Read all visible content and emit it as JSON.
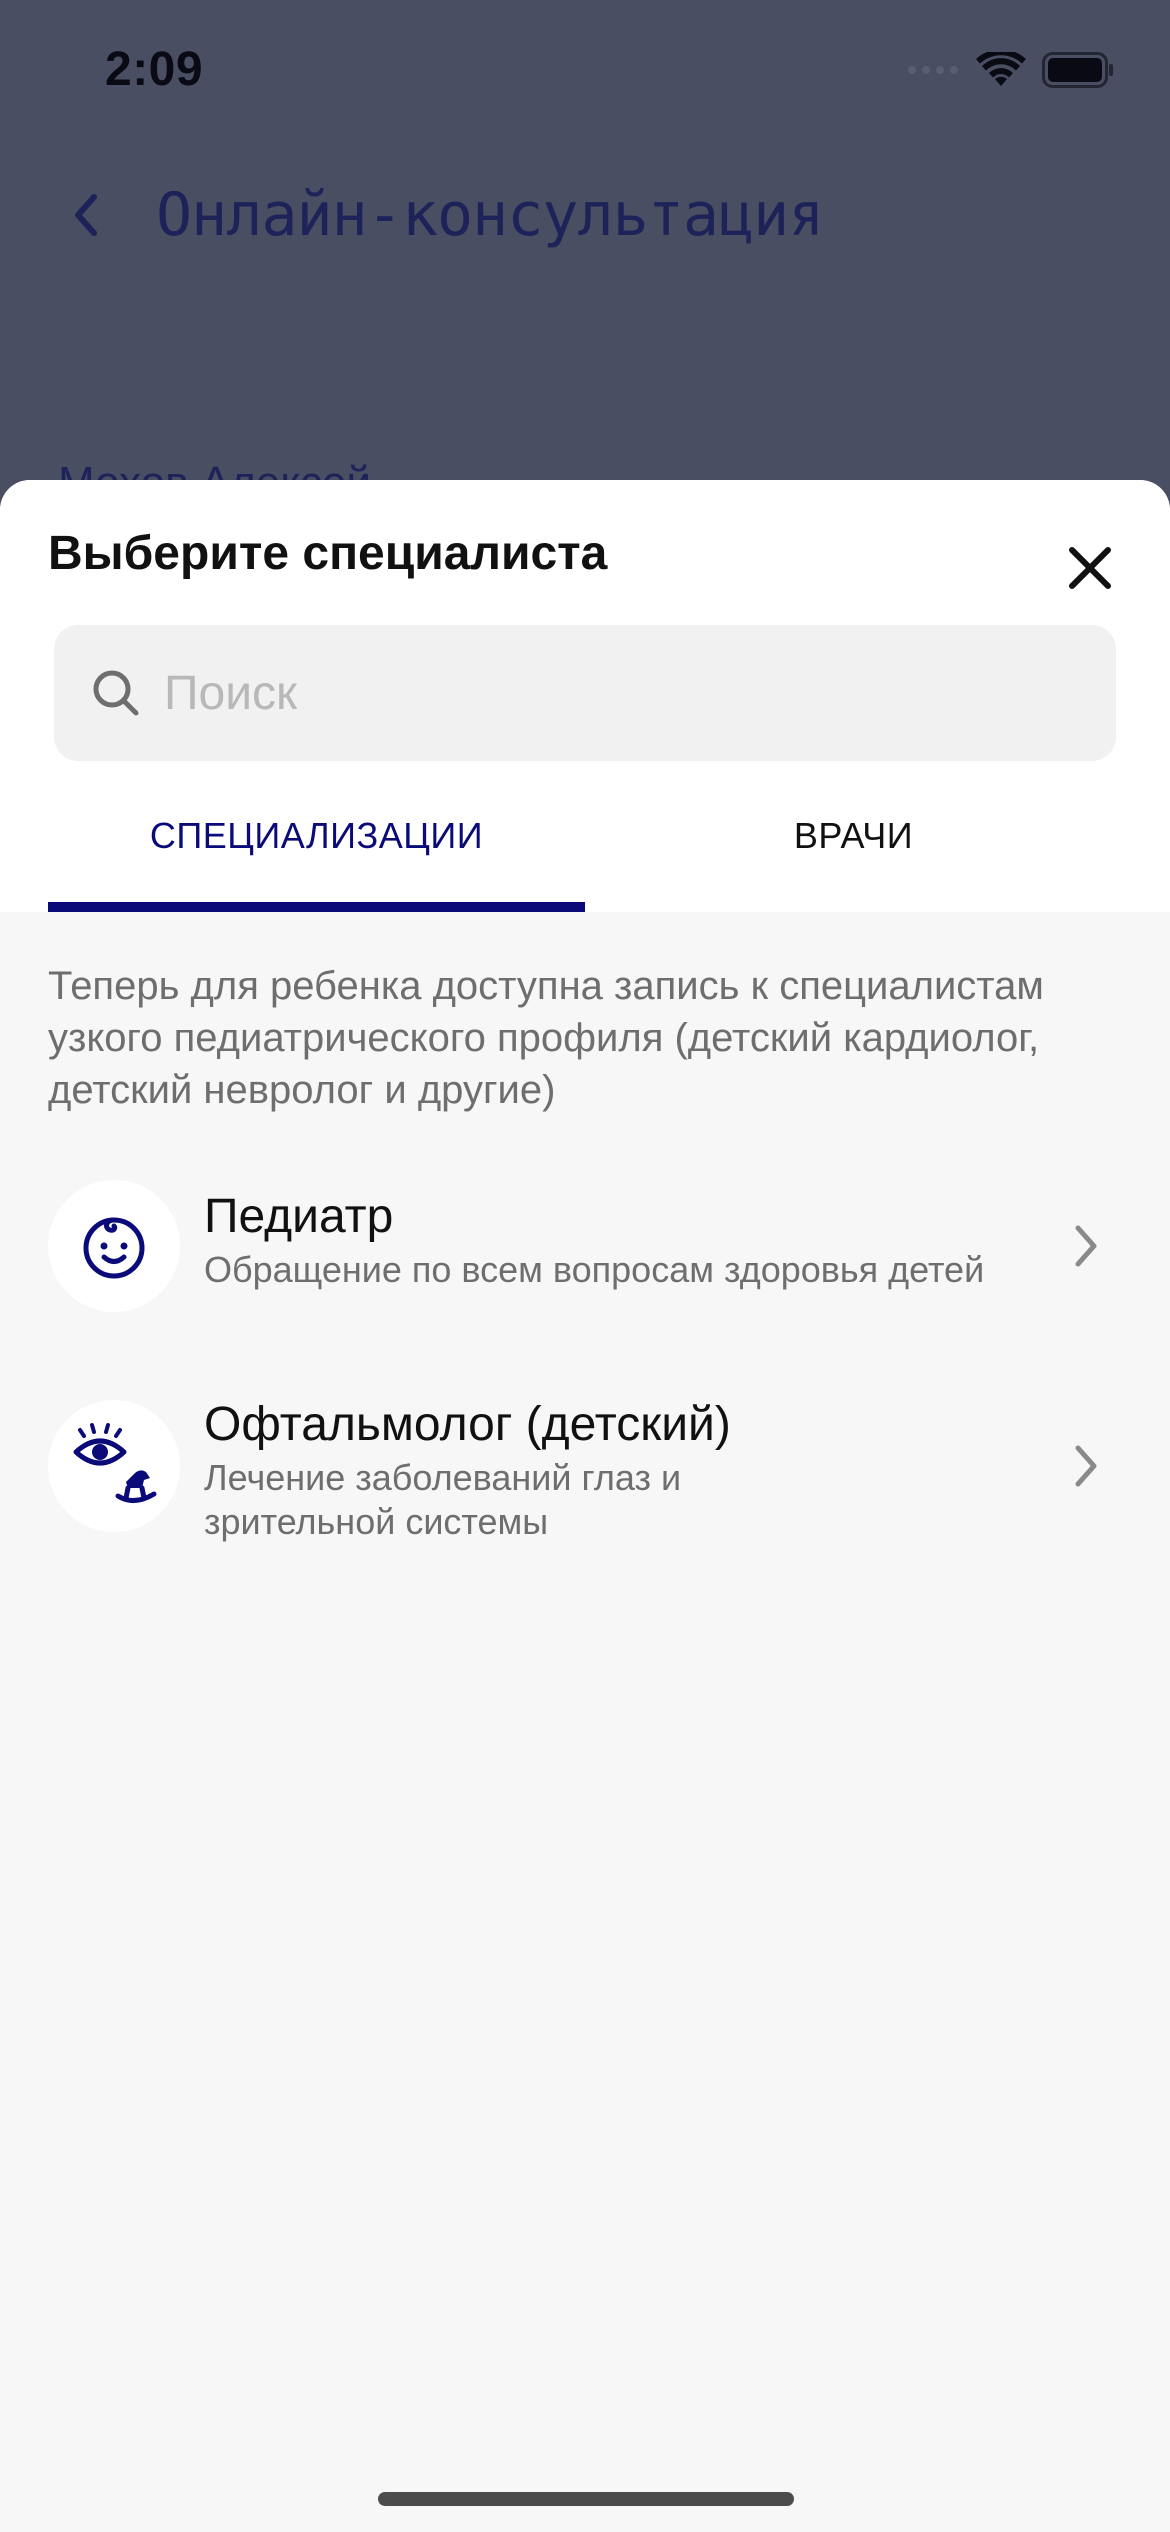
{
  "status_bar": {
    "time": "2:09"
  },
  "background_page": {
    "title": "Онлайн-консультация",
    "user_name": "Мохов Алексей"
  },
  "sheet": {
    "title": "Выберите специалиста",
    "search": {
      "placeholder": "Поиск",
      "value": ""
    },
    "tabs": [
      {
        "label": "СПЕЦИАЛИЗАЦИИ",
        "active": true
      },
      {
        "label": "ВРАЧИ",
        "active": false
      }
    ],
    "info_text": "Теперь для ребенка доступна запись к специалистам узкого педиатрического профиля (детский кардиолог, детский невролог и другие)",
    "specialists": [
      {
        "name": "Педиатр",
        "description": "Обращение по всем вопросам здоровья детей",
        "icon": "baby-face-icon"
      },
      {
        "name": "Офтальмолог (детский)",
        "description": "Лечение заболеваний глаз и зрительной системы",
        "icon": "eye-rocking-horse-icon"
      }
    ]
  },
  "colors": {
    "accent": "#0a0a78",
    "overlay": "#4a4e63",
    "sheet_background": "#f7f7f7",
    "secondary_text": "#6e6e6e"
  }
}
